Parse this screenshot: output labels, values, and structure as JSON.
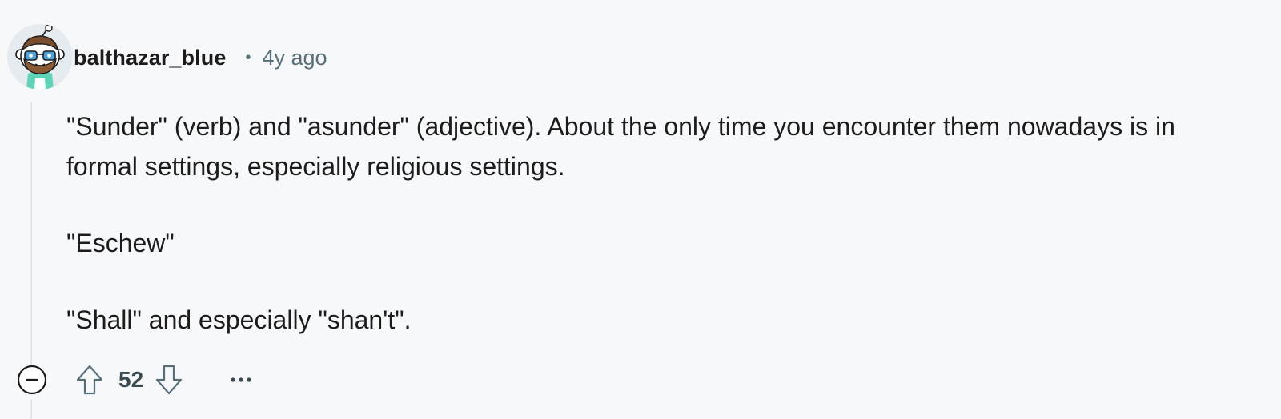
{
  "comment": {
    "author": "balthazar_blue",
    "separator": "•",
    "timestamp": "4y ago",
    "paragraphs": [
      "\"Sunder\" (verb) and \"asunder\" (adjective). About the only time you encounter them nowadays is in formal settings, especially religious settings.",
      "\"Eschew\"",
      "\"Shall\" and especially \"shan't\"."
    ],
    "score": "52"
  },
  "icons": {
    "avatar": "snoo-avatar-glasses-beard",
    "collapse": "minus-circle-icon",
    "upvote": "arrow-up-outline-icon",
    "downvote": "arrow-down-outline-icon",
    "more": "ellipsis-icon"
  },
  "colors": {
    "background": "#f7f8fa",
    "text": "#1c1c1c",
    "muted": "#576f76",
    "thread_line": "#e2e4e7"
  }
}
